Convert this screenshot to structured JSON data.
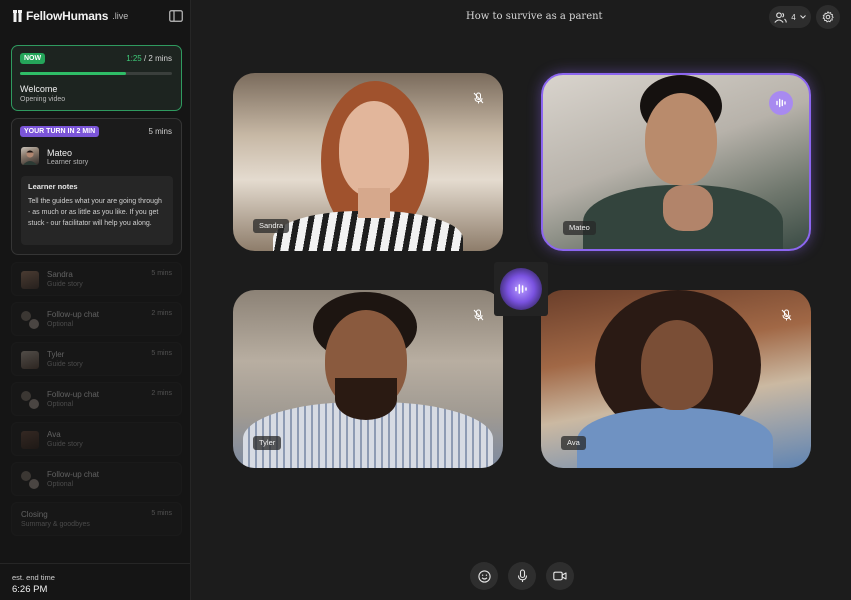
{
  "brand": {
    "name": "FellowHumans",
    "tld": ".live"
  },
  "session": {
    "title": "How to survive as a parent"
  },
  "participants": {
    "count": "4"
  },
  "now": {
    "badge": "NOW",
    "elapsed": "1:25",
    "total": " / 2 mins",
    "progress": 0.7,
    "title": "Welcome",
    "subtitle": "Opening video"
  },
  "turn": {
    "badge": "YOUR TURN IN 2 MIN",
    "duration": "5 mins",
    "name": "Mateo",
    "subtitle": "Learner story",
    "notes_title": "Learner notes",
    "notes_body": "Tell the guides what your are going through - as much or as little as you like. If you get stuck - our facilitator will help you along."
  },
  "agenda": [
    {
      "title": "Sandra",
      "subtitle": "Guide story",
      "duration": "5 mins"
    },
    {
      "title": "Follow-up chat",
      "subtitle": "Optional",
      "duration": "2 mins"
    },
    {
      "title": "Tyler",
      "subtitle": "Guide story",
      "duration": "5 mins"
    },
    {
      "title": "Follow-up chat",
      "subtitle": "Optional",
      "duration": "2 mins"
    },
    {
      "title": "Ava",
      "subtitle": "Guide story",
      "duration": ""
    },
    {
      "title": "Follow-up chat",
      "subtitle": "Optional",
      "duration": ""
    },
    {
      "title": "Closing",
      "subtitle": "Summary & goodbyes",
      "duration": "5 mins"
    }
  ],
  "end_time": {
    "label": "est. end time",
    "value": "6:26 PM"
  },
  "tiles": [
    {
      "name": "Sandra",
      "state": "muted"
    },
    {
      "name": "Mateo",
      "state": "speaking"
    },
    {
      "name": "Tyler",
      "state": "muted"
    },
    {
      "name": "Ava",
      "state": "muted"
    }
  ],
  "colors": {
    "accent_green": "#2fbd67",
    "accent_purple": "#8c66f0",
    "background": "#1c1c1c",
    "sidebar": "#151515"
  },
  "icons": [
    "collapse-sidebar-icon",
    "participants-icon",
    "chevron-down-icon",
    "gear-icon",
    "mic-off-icon",
    "audio-wave-icon",
    "emoji-icon",
    "mic-icon",
    "video-camera-icon"
  ]
}
